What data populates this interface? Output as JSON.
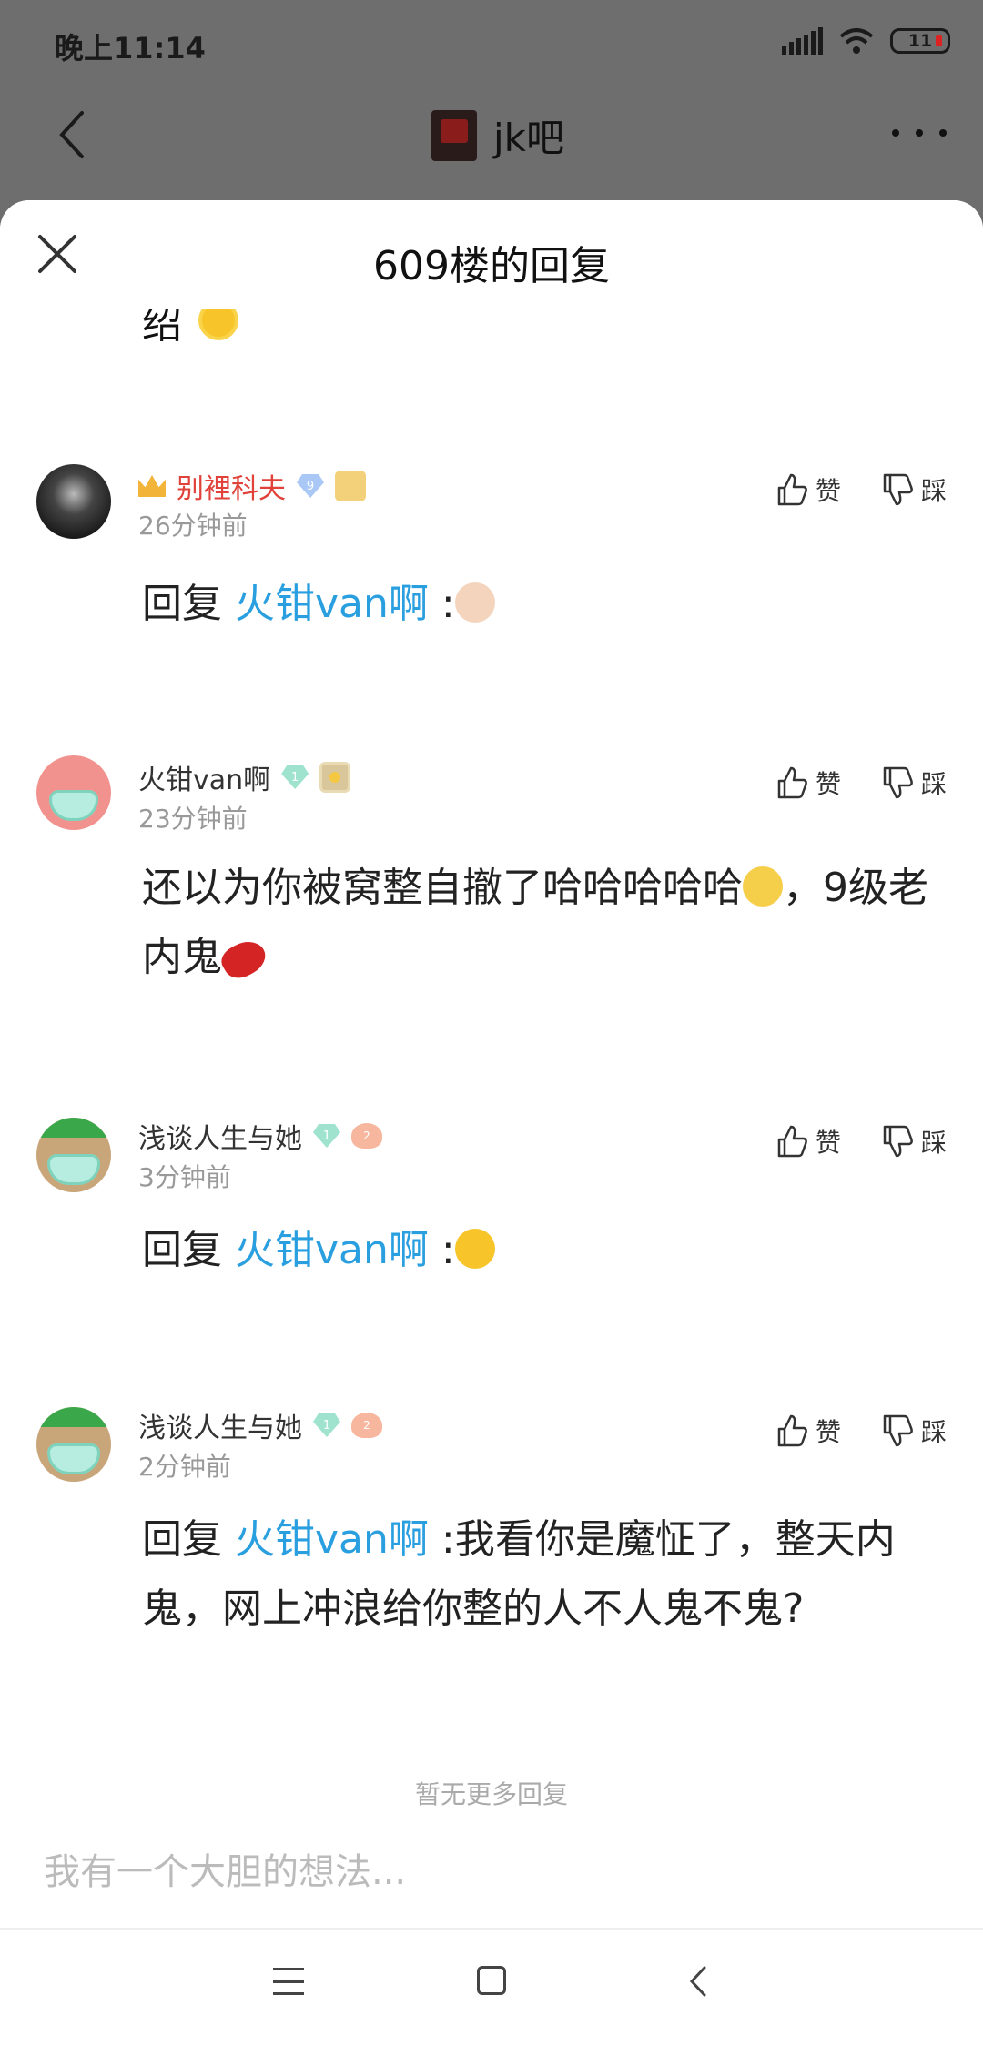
{
  "status_bar": {
    "time": "晚上11:14",
    "battery": "11"
  },
  "nav": {
    "title": "jk吧"
  },
  "sheet": {
    "title": "609楼的回复",
    "partial_text": "绍"
  },
  "replies": [
    {
      "username": "别裡科夫",
      "level": "9",
      "time": "26分钟前",
      "like_label": "赞",
      "dislike_label": "踩",
      "prefix": "回复",
      "mention": "火钳van啊",
      "text": " :"
    },
    {
      "username": "火钳van啊",
      "level": "1",
      "time": "23分钟前",
      "like_label": "赞",
      "dislike_label": "踩",
      "text1": "还以为你被窝整自撤了哈哈哈哈哈",
      "text2": "，9级老内鬼"
    },
    {
      "username": "浅谈人生与她",
      "level": "1",
      "level2": "2",
      "time": "3分钟前",
      "like_label": "赞",
      "dislike_label": "踩",
      "prefix": "回复",
      "mention": "火钳van啊",
      "text": " :"
    },
    {
      "username": "浅谈人生与她",
      "level": "1",
      "level2": "2",
      "time": "2分钟前",
      "like_label": "赞",
      "dislike_label": "踩",
      "prefix": "回复",
      "mention": "火钳van啊",
      "text": " :我看你是魔怔了，整天内鬼，网上冲浪给你整的人不人鬼不鬼?"
    }
  ],
  "footer": {
    "no_more": "暂无更多回复"
  },
  "input": {
    "placeholder": "我有一个大胆的想法..."
  },
  "colors": {
    "mention": "#2a9fe0",
    "admin_name": "#e0423a",
    "time_gray": "#999999"
  }
}
